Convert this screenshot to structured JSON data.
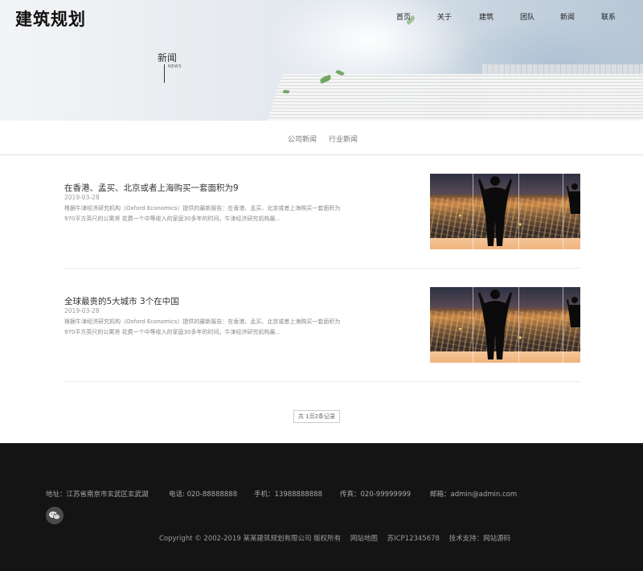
{
  "header": {
    "logo": "建筑规划",
    "nav": [
      {
        "label": "首页"
      },
      {
        "label": "关于"
      },
      {
        "label": "建筑"
      },
      {
        "label": "团队"
      },
      {
        "label": "新闻"
      },
      {
        "label": "联系"
      }
    ]
  },
  "hero": {
    "title": "新闻",
    "subtitle": "NEWS"
  },
  "tabs": [
    {
      "label": "公司新闻"
    },
    {
      "label": "行业新闻"
    }
  ],
  "news": [
    {
      "title": "在香港、孟买、北京或者上海购买一套面积为9",
      "date": "2019-03-28",
      "desc": "根据牛津经济研究机构（Oxford Economics）提供的最新报告：在香港、孟买、北京或者上海购买一套面积为970平方英尺的公寓将 花费一个中等收入的家庭30多年的时间。牛津经济研究机构最..."
    },
    {
      "title": "全球最贵的5大城市 3个在中国",
      "date": "2019-03-28",
      "desc": "根据牛津经济研究机构（Oxford Economics）提供的最新报告：在香港、孟买、北京或者上海购买一套面积为970平方英尺的公寓将 花费一个中等收入的家庭30多年的时间。牛津经济研究机构最..."
    }
  ],
  "pager": {
    "text": "共 1页2条记录"
  },
  "footer": {
    "address": "地址：江苏省南京市玄武区玄武湖",
    "phone": "电话: 020-88888888",
    "mobile": "手机：13988888888",
    "fax": "传真：020-99999999",
    "email": "邮箱：admin@admin.com",
    "copyright": "Copyright © 2002-2019 某某建筑规划有限公司 版权所有",
    "sitemap": "网站地图",
    "icp": "苏ICP12345678",
    "support": "技术支持：网站源码"
  },
  "colors": {
    "footer_bg": "#141414",
    "accent": "#333333"
  }
}
